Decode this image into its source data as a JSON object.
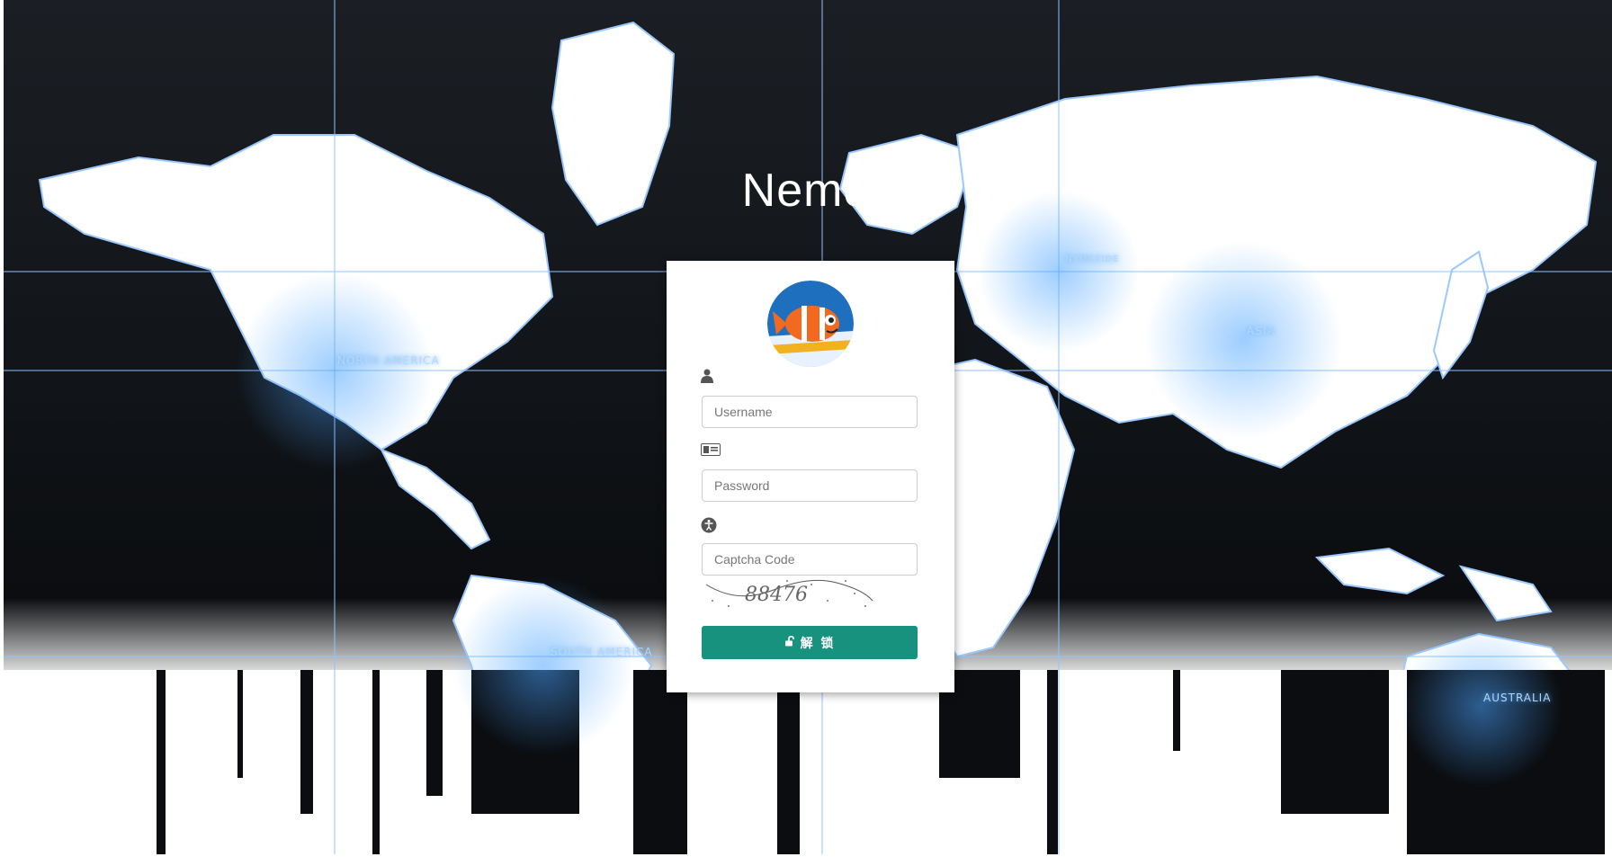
{
  "app": {
    "title": "Nemo"
  },
  "map_labels": {
    "north_america": "NORTH AMERICA",
    "south_america": "SOUTH AMERICA",
    "asia": "ASIA",
    "australia": "AUSTRALIA",
    "nymezide": "NYMEZIDE"
  },
  "login": {
    "avatar_icon": "clownfish-avatar",
    "username": {
      "icon": "user-icon",
      "placeholder": "Username",
      "value": ""
    },
    "password": {
      "icon": "id-card-icon",
      "placeholder": "Password",
      "value": ""
    },
    "captcha": {
      "icon": "accessibility-icon",
      "placeholder": "Captcha Code",
      "value": "",
      "image_text": "88476"
    },
    "submit": {
      "icon": "unlock-icon",
      "label": "解 锁"
    }
  },
  "colors": {
    "button": "#17927f",
    "background_dark": "#111418",
    "map_glow": "#4aa3ff"
  }
}
